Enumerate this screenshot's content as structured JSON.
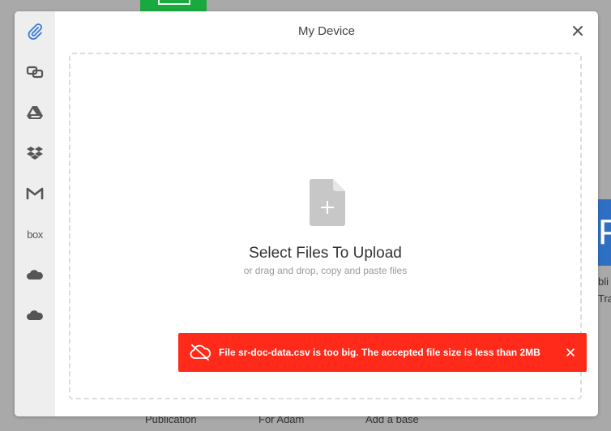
{
  "modal": {
    "title": "My Device",
    "drop_title": "Select Files To Upload",
    "drop_subtitle": "or drag and drop, copy and paste files",
    "error_message": "File sr-doc-data.csv is too big. The accepted file size is less than 2MB"
  },
  "sidebar": {
    "items": [
      {
        "name": "my-device",
        "icon": "paperclip-icon",
        "active": true
      },
      {
        "name": "link",
        "icon": "link-icon"
      },
      {
        "name": "google-drive",
        "icon": "google-drive-icon"
      },
      {
        "name": "dropbox",
        "icon": "dropbox-icon"
      },
      {
        "name": "gmail",
        "icon": "gmail-icon"
      },
      {
        "name": "box",
        "icon": "box-icon",
        "label": "box"
      },
      {
        "name": "onedrive",
        "icon": "onedrive-icon"
      },
      {
        "name": "onedrive-business",
        "icon": "onedrive-business-icon"
      }
    ]
  },
  "background": {
    "bottom_labels": [
      "Publication",
      "For Adam",
      "Add a base"
    ],
    "side_letter": "P",
    "side_text": [
      "bli",
      "Tra"
    ]
  },
  "colors": {
    "error": "#ff2a1a",
    "active_icon": "#3a7bd5",
    "sidebar_bg": "#eeeeef"
  }
}
